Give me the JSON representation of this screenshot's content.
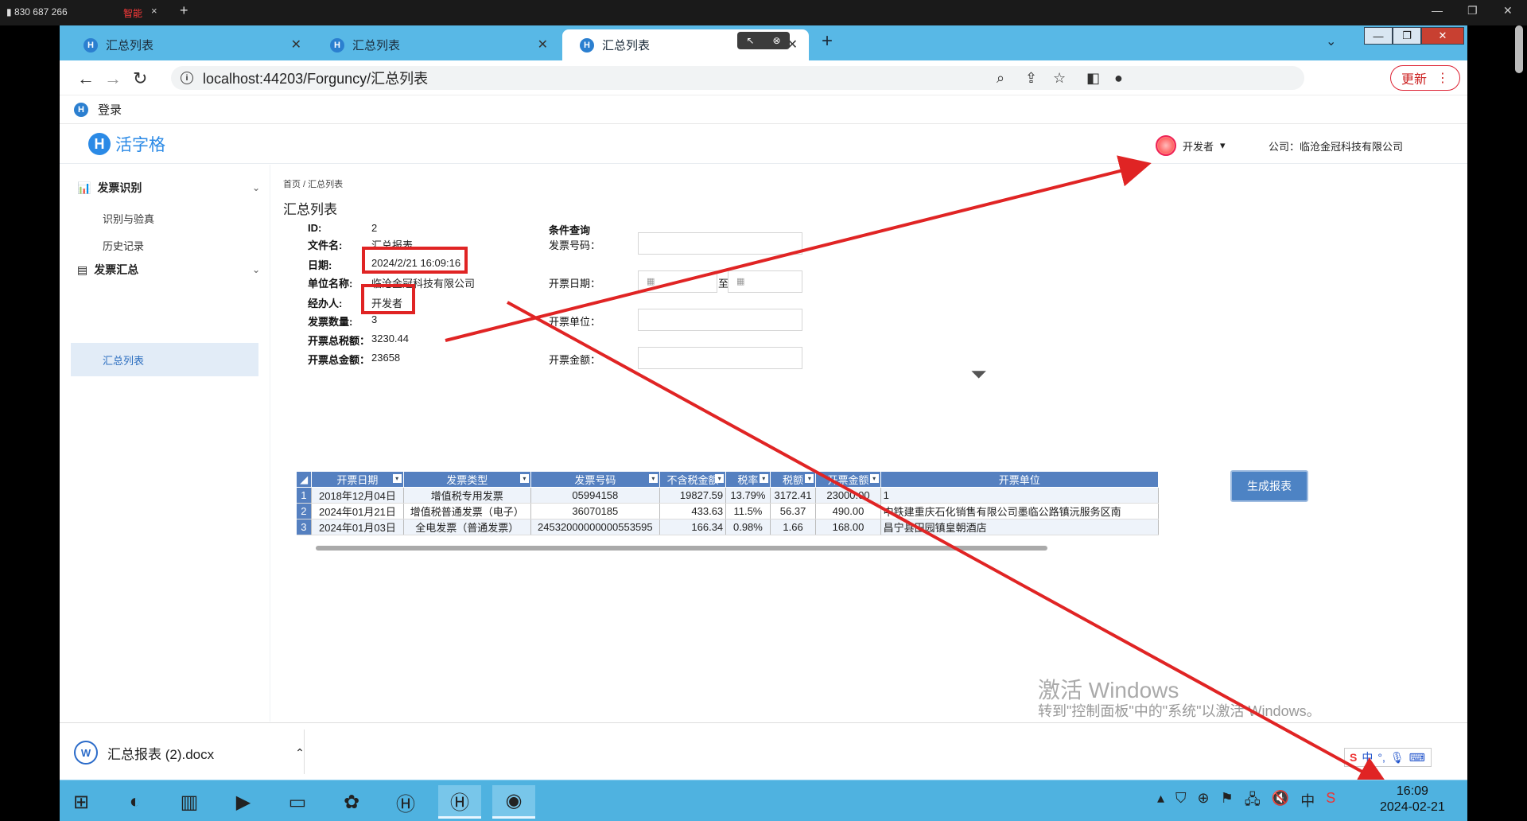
{
  "topstrip": {
    "signal": "830 687 266",
    "smart": "智能",
    "close": "×",
    "new_tab": "+"
  },
  "browser": {
    "tabs": [
      {
        "title": "汇总列表"
      },
      {
        "title": "汇总列表"
      },
      {
        "title": "汇总列表"
      }
    ],
    "url": "localhost:44203/Forguncy/汇总列表",
    "update_label": "更新",
    "bookmark": "登录"
  },
  "app": {
    "logo": "活字格",
    "user": "开发者",
    "company": "公司：临沧金冠科技有限公司",
    "sidebar": {
      "groups": [
        {
          "label": "发票识别",
          "items": [
            "识别与验真",
            "历史记录"
          ]
        },
        {
          "label": "发票汇总",
          "items": [
            "汇总列表"
          ]
        }
      ],
      "active": "汇总列表"
    },
    "breadcrumb": "首页 / 汇总列表",
    "page_title": "汇总列表",
    "details": [
      {
        "label": "ID:",
        "value": "2"
      },
      {
        "label": "文件名:",
        "value": "汇总报表"
      },
      {
        "label": "日期:",
        "value": "2024/2/21 16:09:16"
      },
      {
        "label": "单位名称:",
        "value": "临沧金冠科技有限公司"
      },
      {
        "label": "经办人:",
        "value": "开发者"
      },
      {
        "label": "发票数量:",
        "value": "3"
      },
      {
        "label": "开票总税额：",
        "value": "3230.44"
      },
      {
        "label": "开票总金额：",
        "value": "23658"
      }
    ],
    "query": {
      "title": "条件查询",
      "invoice_no": "发票号码：",
      "date": "开票日期：",
      "to": "至",
      "unit": "开票单位：",
      "amount": "开票金额："
    },
    "grid": {
      "columns": [
        "开票日期",
        "发票类型",
        "发票号码",
        "不含税金额",
        "税率",
        "税额",
        "开票金额",
        "开票单位"
      ],
      "rows": [
        [
          "1",
          "2018年12月04日",
          "增值税专用发票",
          "05994158",
          "19827.59",
          "13.79%",
          "3172.41",
          "23000.00",
          "1"
        ],
        [
          "2",
          "2024年01月21日",
          "增值税普通发票（电子）",
          "36070185",
          "433.63",
          "11.5%",
          "56.37",
          "490.00",
          "中铁建重庆石化销售有限公司墨临公路镇沅服务区南"
        ],
        [
          "3",
          "2024年01月03日",
          "全电发票（普通发票）",
          "24532000000000553595",
          "166.34",
          "0.98%",
          "1.66",
          "168.00",
          "昌宁县田园镇皇朝酒店"
        ]
      ]
    },
    "generate_label": "生成报表"
  },
  "download": {
    "file": "汇总报表 (2).docx"
  },
  "watermark": {
    "line1": "激活 Windows",
    "line2": "转到\"控制面板\"中的\"系统\"以激活 Windows。"
  },
  "taskbar": {
    "time": "16:09",
    "date": "2024-02-21",
    "ime": "中"
  },
  "colors": {
    "tab_bar": "#58b8e6",
    "taskbar": "#4fb2e0",
    "grid_header": "#5580c0",
    "annotation_red": "#e02424",
    "primary": "#2b8ae6"
  }
}
